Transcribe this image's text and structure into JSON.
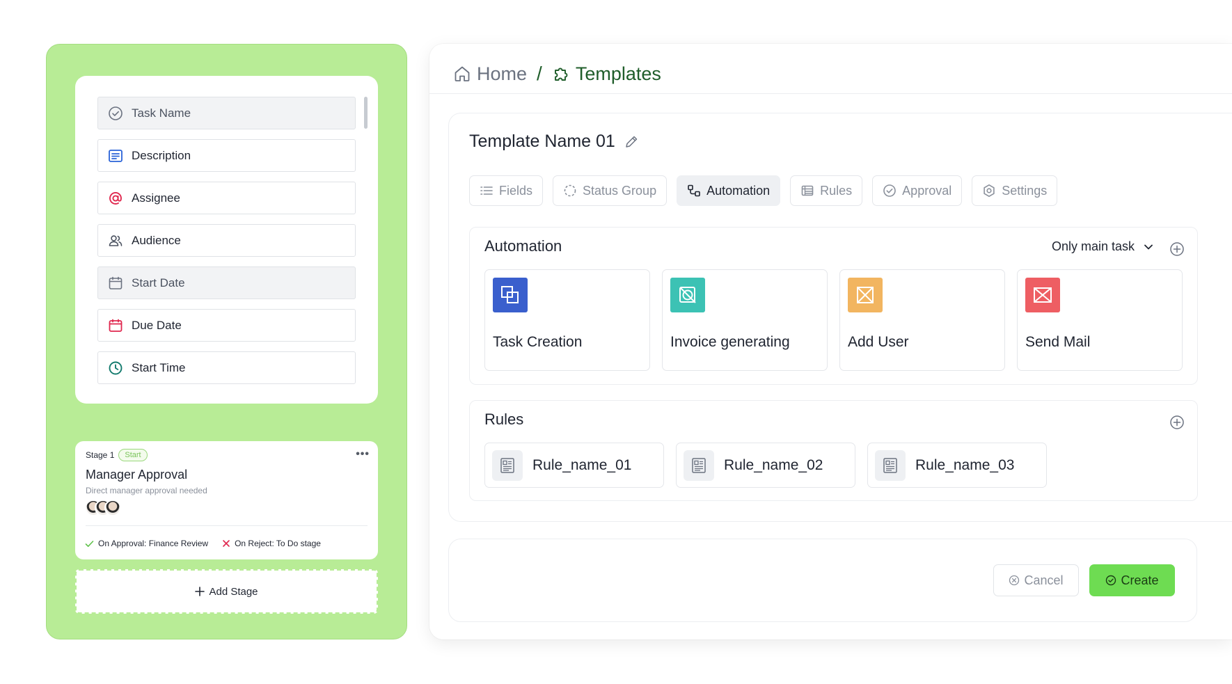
{
  "colors": {
    "panel_green": "#b8ec96",
    "accent_dark_green": "#1f5d2a",
    "create_button": "#6edc52",
    "task_creation_icon": "#3a5fcd",
    "invoice_icon": "#3cc2b4",
    "add_user_icon": "#f2b560",
    "send_mail_icon": "#ee5e63"
  },
  "fields": [
    {
      "label": "Task Name",
      "icon": "check-circle-icon"
    },
    {
      "label": "Description",
      "icon": "text-lines-icon"
    },
    {
      "label": "Assignee",
      "icon": "at-sign-icon"
    },
    {
      "label": "Audience",
      "icon": "users-icon"
    },
    {
      "label": "Start Date",
      "icon": "calendar-icon"
    },
    {
      "label": "Due Date",
      "icon": "calendar-icon"
    },
    {
      "label": "Start Time",
      "icon": "clock-icon"
    }
  ],
  "stage": {
    "label": "Stage 1",
    "badge": "Start",
    "title": "Manager Approval",
    "subtitle": "Direct manager approval needed",
    "on_approval": "On Approval: Finance Review",
    "on_reject": "On Reject: To Do stage"
  },
  "add_stage_label": "Add Stage",
  "breadcrumb": {
    "home": "Home",
    "separator": "/",
    "current": "Templates"
  },
  "template": {
    "name": "Template Name 01"
  },
  "tabs": [
    {
      "label": "Fields",
      "icon": "list-icon",
      "active": false
    },
    {
      "label": "Status Group",
      "icon": "dashed-circle-icon",
      "active": false
    },
    {
      "label": "Automation",
      "icon": "workflow-icon",
      "active": true
    },
    {
      "label": "Rules",
      "icon": "table-icon",
      "active": false
    },
    {
      "label": "Approval",
      "icon": "check-circle-icon",
      "active": false
    },
    {
      "label": "Settings",
      "icon": "gear-icon",
      "active": false
    }
  ],
  "automation": {
    "title": "Automation",
    "filter": "Only main task",
    "cards": [
      {
        "label": "Task Creation",
        "icon": "copy-squares-icon"
      },
      {
        "label": "Invoice generating",
        "icon": "no-receipt-icon"
      },
      {
        "label": "Add User",
        "icon": "box-cross-icon"
      },
      {
        "label": "Send Mail",
        "icon": "envelope-cross-icon"
      }
    ]
  },
  "rules": {
    "title": "Rules",
    "items": [
      {
        "label": "Rule_name_01"
      },
      {
        "label": "Rule_name_02"
      },
      {
        "label": "Rule_name_03"
      }
    ]
  },
  "actions": {
    "cancel": "Cancel",
    "create": "Create"
  }
}
